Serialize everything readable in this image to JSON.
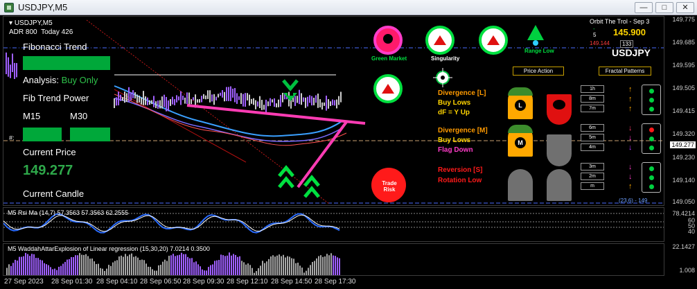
{
  "window": {
    "title": "USDJPY,M5",
    "buttons": [
      "—",
      "□",
      "✕"
    ]
  },
  "main_panel": {
    "header": "USDJPY,M5",
    "adr_label": "ADR 800",
    "today_label": "Today 426",
    "fib_trend": "Fibonacci Trend",
    "analysis_label": "Analysis:",
    "analysis_value": "Buy Only",
    "fib_power": "Fib Trend Power",
    "m15": "M15",
    "m30": "M30",
    "current_price_label": "Current Price",
    "current_price": "149.277",
    "current_candle": "Current Candle",
    "hash_label": "#:",
    "top_right_title": "Orbit The Trol - Sep 3",
    "big_value": "145.900",
    "left_small": "149.144",
    "badge_num": "133",
    "symbol": "USDJPY",
    "minus_val": "-",
    "five_val": "5",
    "level_label": "(23.6) - 149"
  },
  "signals": {
    "green_market": "Green Market",
    "singularity": "Singularity",
    "range_low": "Range Low",
    "price_action": "Price Action",
    "fractal_patterns": "Fractal Patterns",
    "trade_risk": "Trade Risk",
    "div_l_title": "Divergence [L]",
    "div_l_1": "Buy Lows",
    "div_l_2": "dF = Y Up",
    "div_m_title": "Divergence [M]",
    "div_m_1": "Buy Lows",
    "div_m_2": "Flag Down",
    "rev_title": "Reversion [S]",
    "rev_1": "Rotation Low",
    "l_badge": "L",
    "m_badge": "M"
  },
  "timeframes": {
    "group1": [
      "1h",
      "8m",
      "7m"
    ],
    "group2": [
      "6m",
      "5m",
      "4m"
    ],
    "group3": [
      "3m",
      "2m",
      "m"
    ]
  },
  "price_axis": [
    "149.775",
    "149.685",
    "149.595",
    "149.505",
    "149.415",
    "149.320",
    "149.230",
    "149.140",
    "149.050"
  ],
  "current_price_tag": "149.277",
  "rsi_panel": {
    "label": "M5  Rsi Ma (14,7) 57.3563 57.3563 62.2555",
    "levels": [
      "78.4214",
      "60",
      "50",
      "40"
    ]
  },
  "waddah_panel": {
    "label": "M5  WaddahAttarExplosion of Linear regression (15,30,20) 7.0214 0.3500",
    "top_value": "22.1427",
    "bottom_value": "1.008"
  },
  "time_axis": [
    "27 Sep 2023",
    "28 Sep 01:30",
    "28 Sep 04:10",
    "28 Sep 06:50",
    "28 Sep 09:30",
    "28 Sep 12:10",
    "28 Sep 14:50",
    "28 Sep 17:30"
  ],
  "colors": {
    "accent_green": "#00a83a",
    "magenta": "#ff3cc8",
    "orange": "#ff9a00",
    "yellow": "#ffd400",
    "red": "#ff1a1a"
  }
}
